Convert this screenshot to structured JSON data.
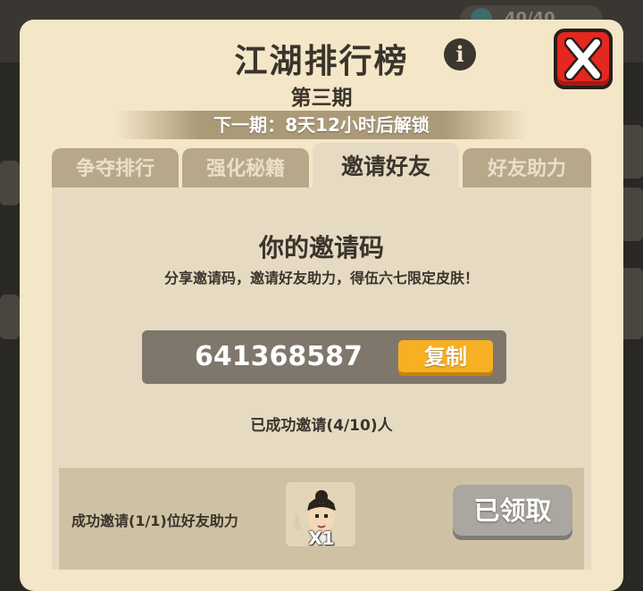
{
  "panel": {
    "title": "江湖排行榜",
    "subtitle": "第三期",
    "unlock_text": "下一期：8天12小时后解锁"
  },
  "background": {
    "resource_value": "40/40"
  },
  "tabs": [
    {
      "label": "争夺排行",
      "active": false
    },
    {
      "label": "强化秘籍",
      "active": false
    },
    {
      "label": "邀请好友",
      "active": true
    },
    {
      "label": "好友助力",
      "active": false
    }
  ],
  "invite": {
    "title": "你的邀请码",
    "description": "分享邀请码，邀请好友助力，得伍六七限定皮肤！",
    "code": "641368587",
    "copy_label": "复制",
    "count_text": "已成功邀请(4/10)人"
  },
  "reward": {
    "label": "成功邀请(1/1)位好友助力",
    "quantity": "X1",
    "claimed_label": "已领取"
  },
  "colors": {
    "panel_bg": "#f4e7c8",
    "close_red": "#e4271f",
    "copy_orange": "#f7b023",
    "claimed_gray": "#aaa6a0"
  }
}
